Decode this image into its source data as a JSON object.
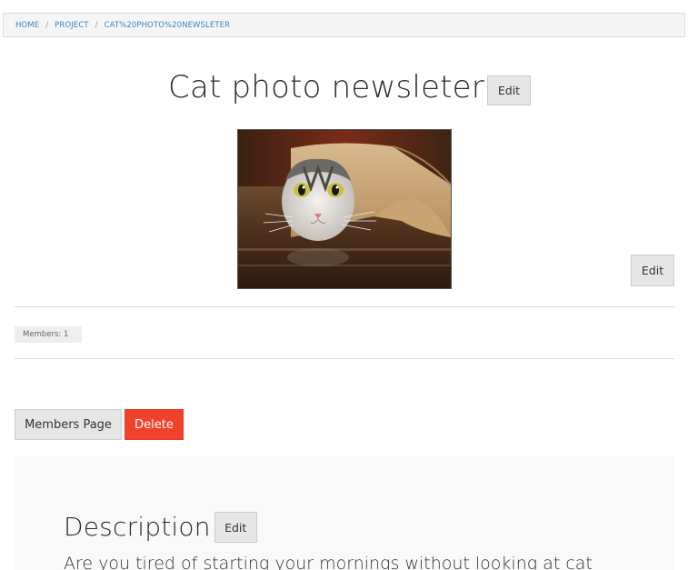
{
  "breadcrumb": {
    "items": [
      "HOME",
      "PROJECT",
      "CAT%20PHOTO%20NEWSLETER"
    ],
    "separator": "/"
  },
  "project": {
    "title": "Cat photo newsleter",
    "edit_title_label": "Edit",
    "edit_image_label": "Edit",
    "image_alt": "cat peeking out of a paper roll",
    "members_badge": "Members: 1"
  },
  "actions": {
    "members_page_label": "Members Page",
    "delete_label": "Delete"
  },
  "description": {
    "heading": "Description",
    "edit_label": "Edit",
    "text": "Are you tired of starting your mornings without looking at cat"
  },
  "colors": {
    "breadcrumb_link": "#3b87c7",
    "delete_button": "#f0412a",
    "panel_bg": "#f9f9f9",
    "button_bg": "#e6e6e6"
  }
}
